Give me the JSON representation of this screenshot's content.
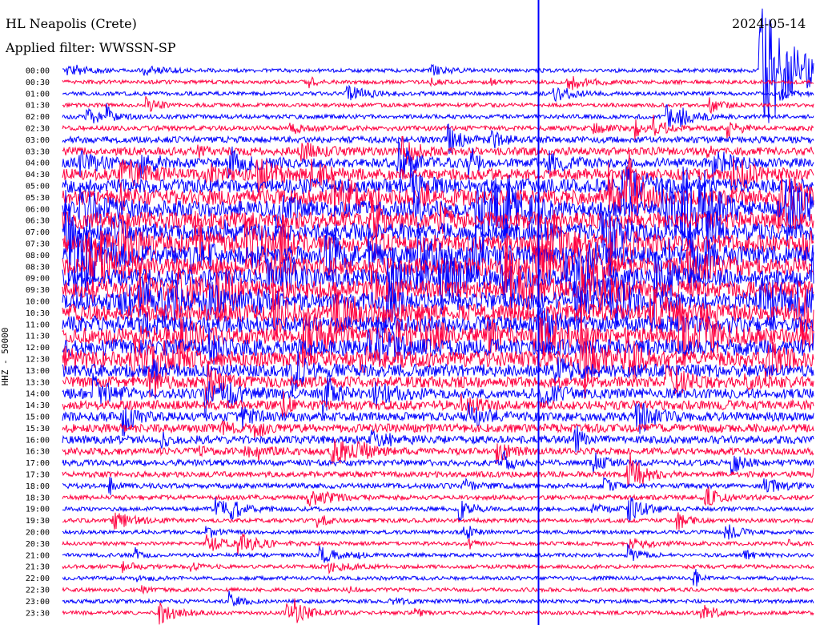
{
  "header": {
    "station": "HL Neapolis (Crete)",
    "filter": "Applied filter: WWSSN-SP",
    "date": "2024-05-14"
  },
  "channel_label": "HHZ - 50000",
  "chart_data": {
    "type": "helicorder",
    "station": "HL Neapolis (Crete)",
    "filter": "WWSSN-SP",
    "channel": "HHZ",
    "scale": "50000",
    "date": "2024-05-14",
    "line_duration_min": 30,
    "tick_labels": [
      "00:00",
      "00:30",
      "01:00",
      "01:30",
      "02:00",
      "02:30",
      "03:00",
      "03:30",
      "04:00",
      "04:30",
      "05:00",
      "05:30",
      "06:00",
      "06:30",
      "07:00",
      "07:30",
      "08:00",
      "08:30",
      "09:00",
      "09:30",
      "10:00",
      "10:30",
      "11:00",
      "11:30",
      "12:00",
      "12:30",
      "13:00",
      "13:30",
      "14:00",
      "14:30",
      "15:00",
      "15:30",
      "16:00",
      "16:30",
      "17:00",
      "17:30",
      "18:00",
      "18:30",
      "19:00",
      "19:30",
      "20:00",
      "20:30",
      "21:00",
      "21:30",
      "22:00",
      "22:30",
      "23:00",
      "23:30"
    ],
    "trace_colors": [
      "#0000ff",
      "#ff0040"
    ],
    "noise_level": [
      1,
      1,
      1,
      1,
      1.2,
      1.4,
      2,
      2.6,
      3.2,
      4,
      5,
      5.5,
      6,
      6.2,
      6.4,
      6.5,
      6.6,
      6.6,
      6.5,
      6.5,
      6.4,
      6.3,
      6.1,
      6,
      6,
      5.6,
      4.5,
      3.8,
      3.4,
      3.2,
      3,
      2.8,
      2.6,
      2.2,
      1.9,
      1.7,
      1.5,
      1.3,
      1.2,
      1.1,
      1,
      1,
      1,
      1,
      1,
      1,
      1,
      1
    ],
    "large_event": {
      "line": 0,
      "x_fraction": 0.97
    }
  }
}
